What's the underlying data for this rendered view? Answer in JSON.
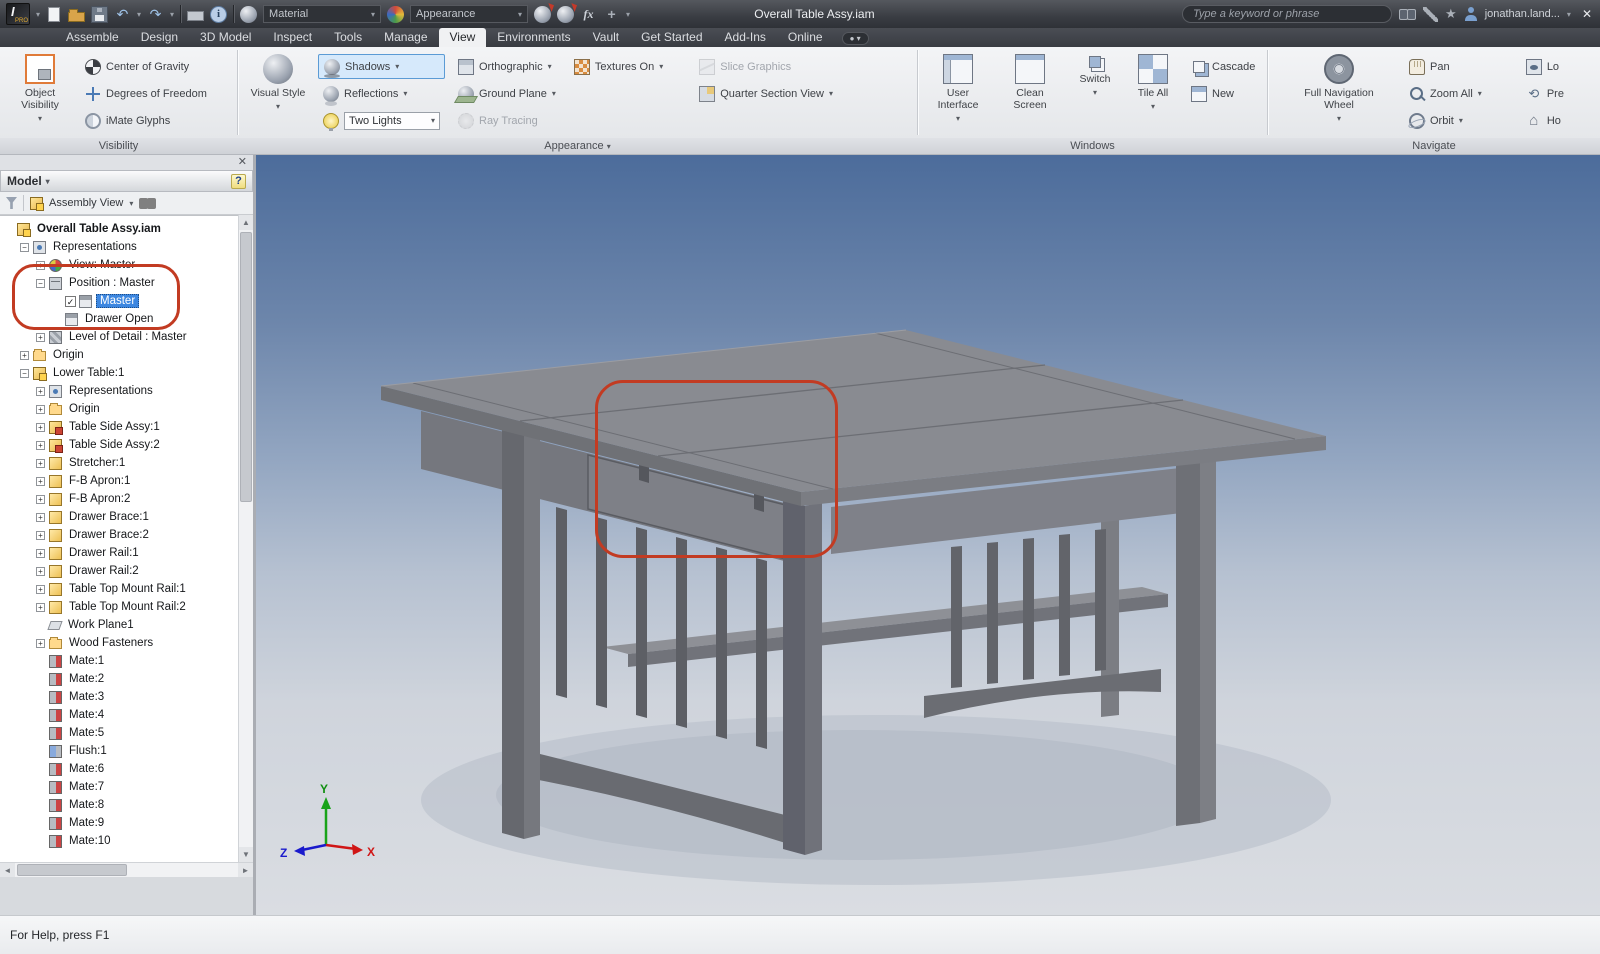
{
  "titlebar": {
    "logo_text": "I",
    "logo_sub": "PRO",
    "material_value": "Material",
    "appearance_value": "Appearance",
    "document_title": "Overall Table Assy.iam",
    "search_placeholder": "Type a keyword or phrase",
    "user_name": "jonathan.land..."
  },
  "ribbon": {
    "tabs": [
      {
        "label": "Assemble",
        "active": false
      },
      {
        "label": "Design",
        "active": false
      },
      {
        "label": "3D Model",
        "active": false
      },
      {
        "label": "Inspect",
        "active": false
      },
      {
        "label": "Tools",
        "active": false
      },
      {
        "label": "Manage",
        "active": false
      },
      {
        "label": "View",
        "active": true
      },
      {
        "label": "Environments",
        "active": false
      },
      {
        "label": "Vault",
        "active": false
      },
      {
        "label": "Get Started",
        "active": false
      },
      {
        "label": "Add-Ins",
        "active": false
      },
      {
        "label": "Online",
        "active": false
      }
    ],
    "visibility": {
      "label": "Visibility",
      "object_visibility": "Object Visibility",
      "center_of_gravity": "Center of Gravity",
      "degrees_of_freedom": "Degrees of Freedom",
      "imate_glyphs": "iMate Glyphs"
    },
    "appearance": {
      "label": "Appearance",
      "visual_style": "Visual Style",
      "shadows": "Shadows",
      "reflections": "Reflections",
      "lights_value": "Two Lights",
      "orthographic": "Orthographic",
      "ground_plane": "Ground Plane",
      "ray_tracing": "Ray Tracing",
      "textures": "Textures On",
      "slice_graphics": "Slice Graphics",
      "quarter_section": "Quarter Section View"
    },
    "windows": {
      "label": "Windows",
      "user_interface": "User Interface",
      "clean_screen": "Clean Screen",
      "switch": "Switch",
      "tile_all": "Tile All",
      "cascade": "Cascade",
      "new": "New"
    },
    "navigate": {
      "label": "Navigate",
      "full_navigation_wheel": "Full Navigation Wheel",
      "pan": "Pan",
      "zoom_all": "Zoom All",
      "orbit": "Orbit",
      "extra": [
        {
          "label": "Lo",
          "icon": "look"
        },
        {
          "label": "Pre",
          "icon": "prev"
        },
        {
          "label": "Ho",
          "icon": "home"
        }
      ]
    }
  },
  "browser": {
    "header": {
      "title": "Model"
    },
    "toolbar": {
      "view_mode": "Assembly View"
    },
    "tree": [
      {
        "l": "Overall Table Assy.iam",
        "d": 0,
        "e": null,
        "i": "asm",
        "b": true
      },
      {
        "l": "Representations",
        "d": 1,
        "e": "-",
        "i": "reps"
      },
      {
        "l": "View: Master",
        "d": 2,
        "e": "+",
        "i": "view"
      },
      {
        "l": "Position : Master",
        "d": 2,
        "e": "-",
        "i": "pos"
      },
      {
        "l": "Master",
        "d": 3,
        "e": null,
        "i": "posm",
        "c": true,
        "s": true
      },
      {
        "l": "Drawer Open",
        "d": 3,
        "e": null,
        "i": "posm"
      },
      {
        "l": "Level of Detail : Master",
        "d": 2,
        "e": "+",
        "i": "lod"
      },
      {
        "l": "Origin",
        "d": 1,
        "e": "+",
        "i": "folder"
      },
      {
        "l": "Lower Table:1",
        "d": 1,
        "e": "-",
        "i": "asm"
      },
      {
        "l": "Representations",
        "d": 2,
        "e": "+",
        "i": "reps"
      },
      {
        "l": "Origin",
        "d": 2,
        "e": "+",
        "i": "folder"
      },
      {
        "l": "Table Side Assy:1",
        "d": 2,
        "e": "+",
        "i": "asm2"
      },
      {
        "l": "Table Side Assy:2",
        "d": 2,
        "e": "+",
        "i": "asm2"
      },
      {
        "l": "Stretcher:1",
        "d": 2,
        "e": "+",
        "i": "part"
      },
      {
        "l": "F-B Apron:1",
        "d": 2,
        "e": "+",
        "i": "part"
      },
      {
        "l": "F-B Apron:2",
        "d": 2,
        "e": "+",
        "i": "part"
      },
      {
        "l": "Drawer Brace:1",
        "d": 2,
        "e": "+",
        "i": "part"
      },
      {
        "l": "Drawer Brace:2",
        "d": 2,
        "e": "+",
        "i": "part"
      },
      {
        "l": "Drawer Rail:1",
        "d": 2,
        "e": "+",
        "i": "part"
      },
      {
        "l": "Drawer Rail:2",
        "d": 2,
        "e": "+",
        "i": "part"
      },
      {
        "l": "Table Top Mount Rail:1",
        "d": 2,
        "e": "+",
        "i": "part"
      },
      {
        "l": "Table Top Mount Rail:2",
        "d": 2,
        "e": "+",
        "i": "part"
      },
      {
        "l": "Work Plane1",
        "d": 2,
        "e": null,
        "i": "plane"
      },
      {
        "l": "Wood Fasteners",
        "d": 2,
        "e": "+",
        "i": "folder"
      },
      {
        "l": "Mate:1",
        "d": 2,
        "e": null,
        "i": "mate"
      },
      {
        "l": "Mate:2",
        "d": 2,
        "e": null,
        "i": "mate"
      },
      {
        "l": "Mate:3",
        "d": 2,
        "e": null,
        "i": "mate"
      },
      {
        "l": "Mate:4",
        "d": 2,
        "e": null,
        "i": "mate"
      },
      {
        "l": "Mate:5",
        "d": 2,
        "e": null,
        "i": "mate"
      },
      {
        "l": "Flush:1",
        "d": 2,
        "e": null,
        "i": "flush"
      },
      {
        "l": "Mate:6",
        "d": 2,
        "e": null,
        "i": "mate"
      },
      {
        "l": "Mate:7",
        "d": 2,
        "e": null,
        "i": "mate"
      },
      {
        "l": "Mate:8",
        "d": 2,
        "e": null,
        "i": "mate"
      },
      {
        "l": "Mate:9",
        "d": 2,
        "e": null,
        "i": "mate"
      },
      {
        "l": "Mate:10",
        "d": 2,
        "e": null,
        "i": "mate"
      }
    ]
  },
  "viewport": {
    "triad": {
      "x": "X",
      "y": "Y",
      "z": "Z"
    }
  },
  "status": {
    "text": "For Help, press F1"
  },
  "colors": {
    "annotation_red": "#c23b22",
    "selection_blue": "#3d87e0",
    "shadows_highlight": "#d6e9fb",
    "viewport_top": "#4f6f9e",
    "viewport_bottom": "#d6d9de"
  }
}
